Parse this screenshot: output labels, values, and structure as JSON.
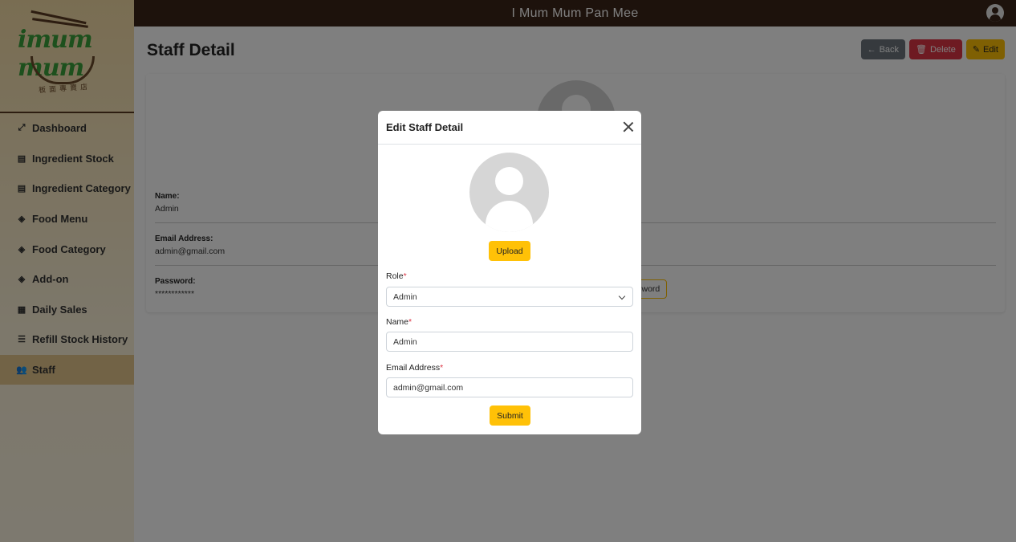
{
  "app": {
    "title": "I Mum Mum Pan Mee"
  },
  "logo": {
    "text": "imum mum"
  },
  "sidebar": {
    "items": [
      {
        "label": "Dashboard",
        "icon": "chart-line-icon",
        "glyph": "⤢"
      },
      {
        "label": "Ingredient Stock",
        "icon": "boxes-icon",
        "glyph": "▤"
      },
      {
        "label": "Ingredient Category",
        "icon": "boxes-icon",
        "glyph": "▤"
      },
      {
        "label": "Food Menu",
        "icon": "layer-group-icon",
        "glyph": "◈"
      },
      {
        "label": "Food Category",
        "icon": "layer-group-icon",
        "glyph": "◈"
      },
      {
        "label": "Add-on",
        "icon": "layer-group-icon",
        "glyph": "◈"
      },
      {
        "label": "Daily Sales",
        "icon": "calendar-icon",
        "glyph": "▦"
      },
      {
        "label": "Refill Stock History",
        "icon": "table-list-icon",
        "glyph": "☰"
      },
      {
        "label": "Staff",
        "icon": "users-icon",
        "glyph": "👥",
        "active": true
      }
    ]
  },
  "page": {
    "title": "Staff Detail",
    "actions": {
      "back": "Back",
      "delete": "Delete",
      "edit": "Edit"
    },
    "fields": {
      "name_label": "Name:",
      "name_value": "Admin",
      "email_label": "Email Address:",
      "email_value": "admin@gmail.com",
      "password_label": "Password:",
      "password_value": "************"
    },
    "change_password": "ssword"
  },
  "modal": {
    "title": "Edit Staff Detail",
    "upload_label": "Upload",
    "role_label": "Role",
    "role_value": "Admin",
    "name_label": "Name",
    "name_value": "Admin",
    "email_label": "Email Address",
    "email_value": "admin@gmail.com",
    "required_mark": "*",
    "submit_label": "Submit"
  },
  "colors": {
    "topbar": "#3b2418",
    "accent": "#ffc107",
    "danger": "#dc3545",
    "secondary": "#6c757d",
    "sidebar_active": "#e4c78d"
  }
}
